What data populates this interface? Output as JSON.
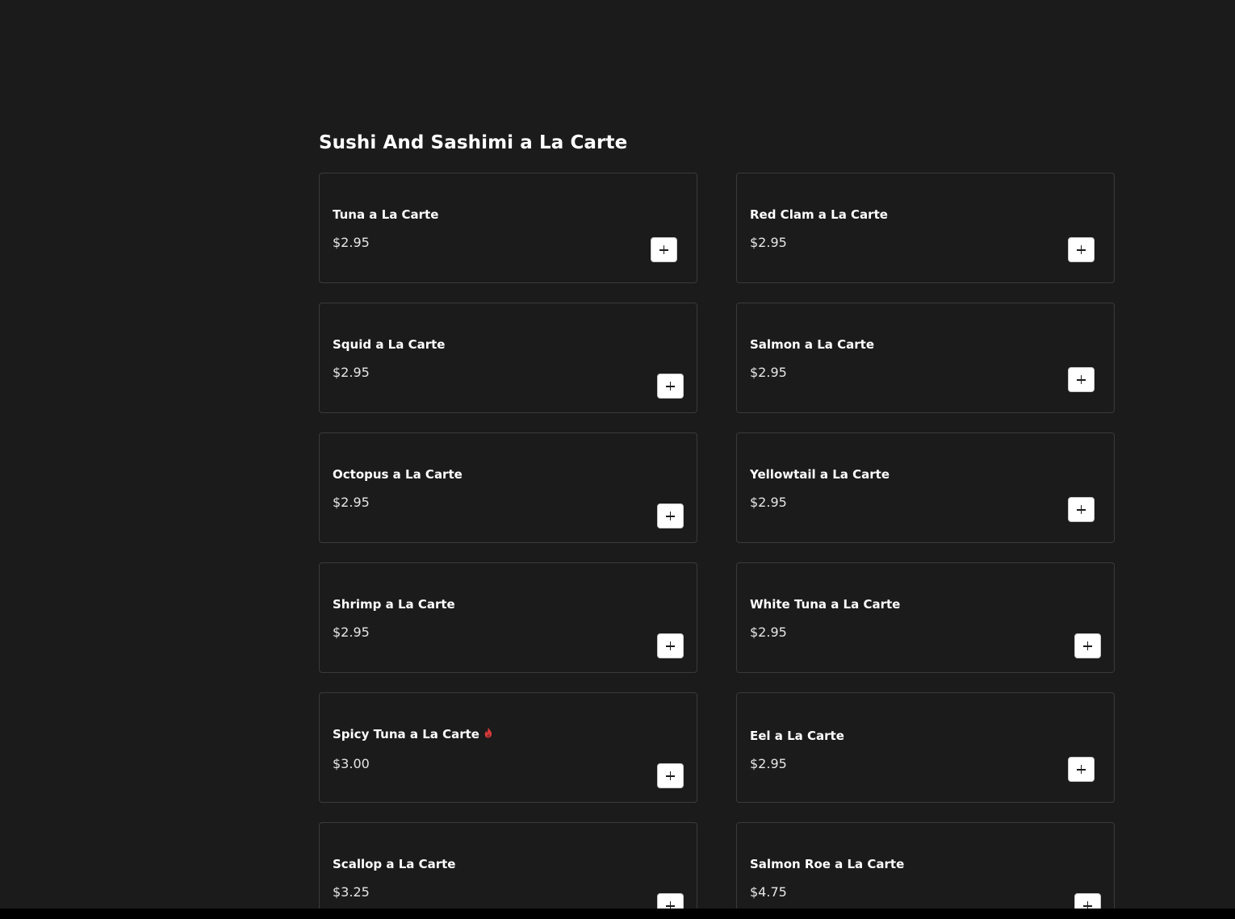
{
  "section": {
    "title": "Sushi And Sashimi a La Carte"
  },
  "items": [
    {
      "name": "Tuna a La Carte",
      "price": "$2.95",
      "spicy": false
    },
    {
      "name": "Red Clam a La Carte",
      "price": "$2.95",
      "spicy": false
    },
    {
      "name": "Squid a La Carte",
      "price": "$2.95",
      "spicy": false
    },
    {
      "name": "Salmon a La Carte",
      "price": "$2.95",
      "spicy": false
    },
    {
      "name": "Octopus a La Carte",
      "price": "$2.95",
      "spicy": false
    },
    {
      "name": "Yellowtail a La Carte",
      "price": "$2.95",
      "spicy": false
    },
    {
      "name": "Shrimp a La Carte",
      "price": "$2.95",
      "spicy": false
    },
    {
      "name": "White Tuna a La Carte",
      "price": "$2.95",
      "spicy": false
    },
    {
      "name": "Spicy Tuna a La Carte",
      "price": "$3.00",
      "spicy": true
    },
    {
      "name": "Eel a La Carte",
      "price": "$2.95",
      "spicy": false
    },
    {
      "name": "Scallop a La Carte",
      "price": "$3.25",
      "spicy": false
    },
    {
      "name": "Salmon Roe a La Carte",
      "price": "$4.75",
      "spicy": false
    }
  ],
  "icons": {
    "add": "plus-icon",
    "spicy": "flame-icon"
  },
  "colors": {
    "background": "#1b1b1b",
    "card_border": "#3a3a3a",
    "spicy": "#d9393a",
    "button": "#ffffff"
  }
}
